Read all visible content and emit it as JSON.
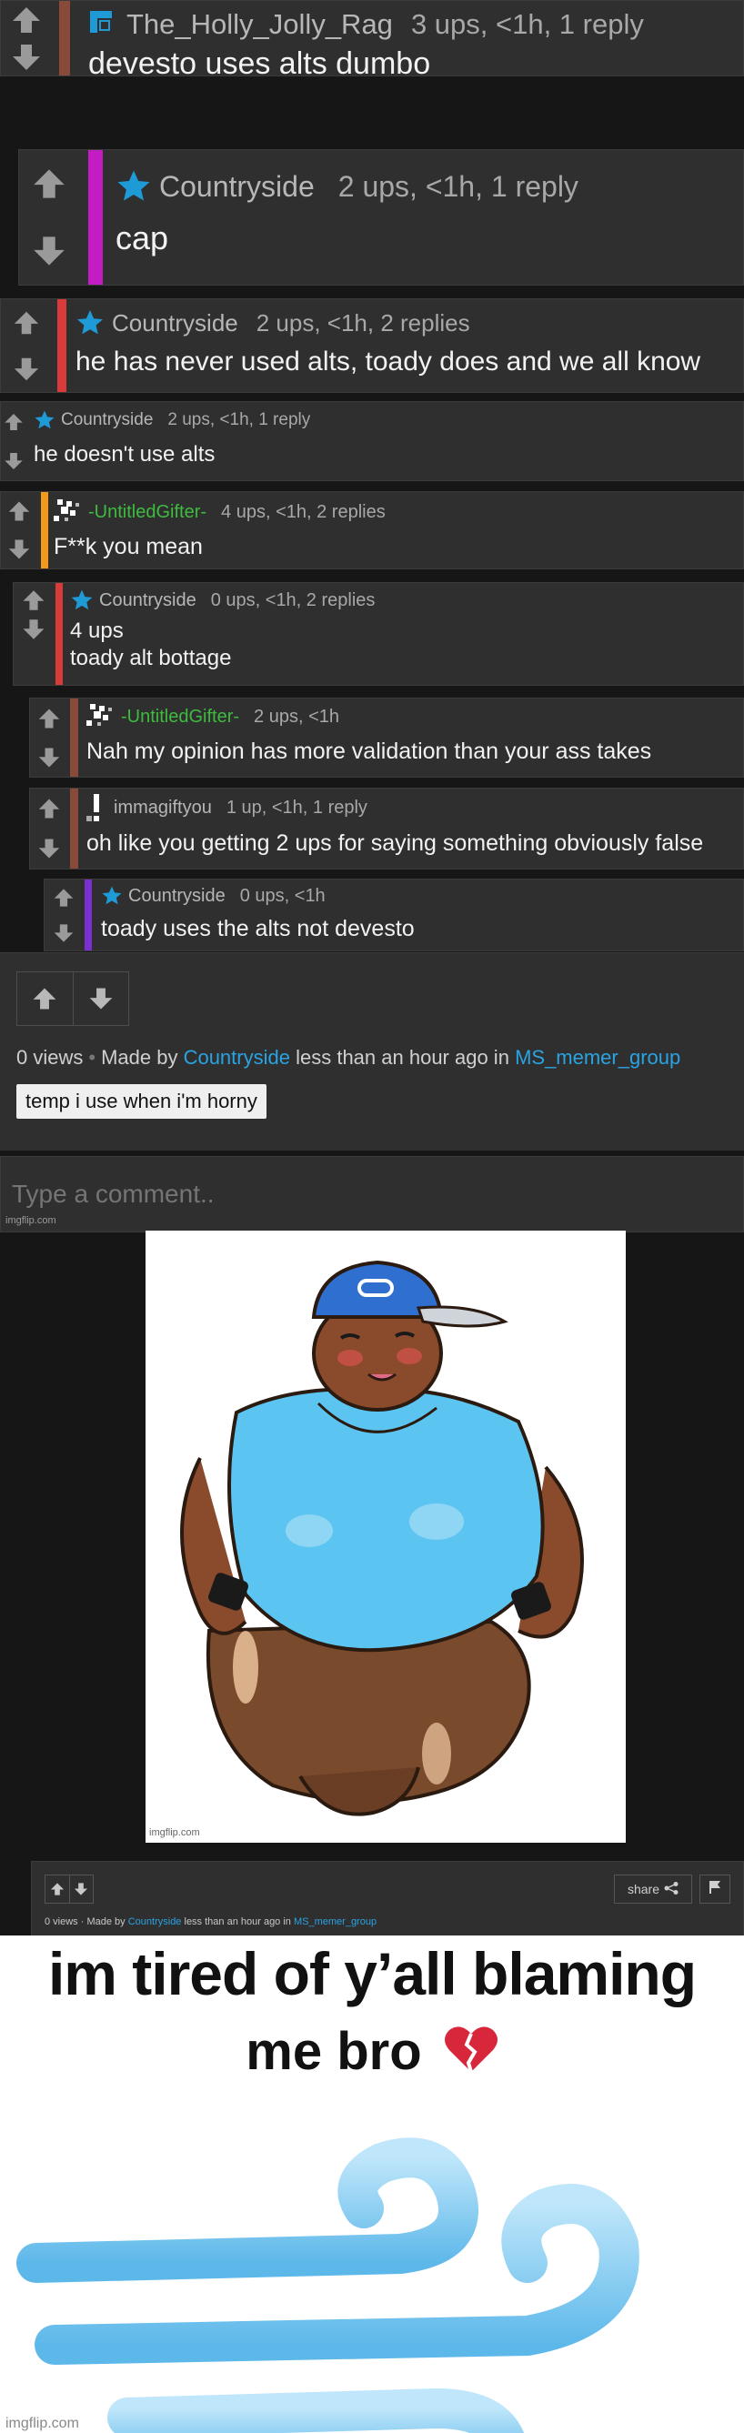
{
  "comments": [
    {
      "user": "The_Holly_Jolly_Rag",
      "stats": "3 ups, <1h, 1 reply",
      "text": [
        "devesto uses alts dumbo"
      ]
    },
    {
      "user": "Countryside",
      "stats": "2 ups, <1h, 1 reply",
      "text": [
        "cap"
      ]
    },
    {
      "user": "Countryside",
      "stats": "2 ups, <1h, 2 replies",
      "text": [
        "he has never used alts, toady does and we all know"
      ]
    },
    {
      "user": "Countryside",
      "stats": "2 ups, <1h, 1 reply",
      "text": [
        "he doesn't use alts"
      ]
    },
    {
      "user": "-UntitledGifter-",
      "stats": "4 ups, <1h, 2 replies",
      "text": [
        "F**k you mean"
      ]
    },
    {
      "user": "Countryside",
      "stats": "0 ups, <1h, 2 replies",
      "text": [
        "4 ups",
        "toady alt bottage"
      ]
    },
    {
      "user": "-UntitledGifter-",
      "stats": "2 ups, <1h",
      "text": [
        "Nah my opinion has more validation than your ass takes"
      ]
    },
    {
      "user": "immagiftyou",
      "stats": "1 up, <1h, 1 reply",
      "text": [
        "oh like you getting 2 ups for saying something obviously false"
      ]
    },
    {
      "user": "Countryside",
      "stats": "0 ups, <1h",
      "text": [
        "toady uses the alts not devesto"
      ]
    }
  ],
  "post": {
    "views": "0 views",
    "made_by_prefix": "Made by",
    "author": "Countryside",
    "time": "less than an hour ago in",
    "group": "MS_memer_group",
    "tag": "temp i use when i'm horny",
    "comment_placeholder": "Type a comment..",
    "watermark": "imgflip.com"
  },
  "embedded_post": {
    "share_label": "share",
    "meta_views": "0 views",
    "meta_made_by": "Made by",
    "meta_author": "Countryside",
    "meta_time": "less than an hour ago in",
    "meta_group": "MS_memer_group"
  },
  "meme": {
    "line1": "im tired of y’all blaming",
    "line2": "me bro",
    "watermark": "imgflip.com"
  },
  "colors": {
    "accent_link": "#2aa3e3",
    "user_green": "#3fbb3f",
    "bar_red": "#d93a3a",
    "bar_magenta": "#c21cc2",
    "bar_orange": "#f29a1a",
    "bar_brown": "#8a4a3a",
    "bar_purple": "#7a2fd0"
  }
}
